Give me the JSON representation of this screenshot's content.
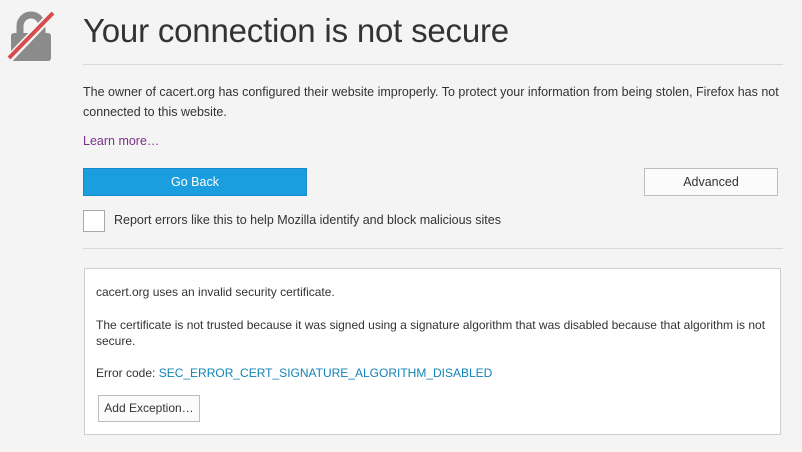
{
  "page": {
    "title": "Your connection is not secure",
    "description": "The owner of cacert.org has configured their website improperly. To protect your information from being stolen, Firefox has not connected to this website.",
    "learn_more": "Learn more…"
  },
  "buttons": {
    "go_back": "Go Back",
    "advanced": "Advanced",
    "add_exception": "Add Exception…"
  },
  "report": {
    "label": "Report errors like this to help Mozilla identify and block malicious sites",
    "checked": false
  },
  "advanced": {
    "line1": "cacert.org uses an invalid security certificate.",
    "line2": "The certificate is not trusted because it was signed using a signature algorithm that was disabled because that algorithm is not secure.",
    "error_prefix": "Error code: ",
    "error_code": "SEC_ERROR_CERT_SIGNATURE_ALGORITHM_DISABLED"
  },
  "icons": {
    "lock": "broken-lock-icon"
  },
  "colors": {
    "primary_button": "#1a9ee0",
    "link_visited": "#7d2f8c",
    "error_code_link": "#1283b8",
    "lock_slash": "#d64b4b"
  }
}
